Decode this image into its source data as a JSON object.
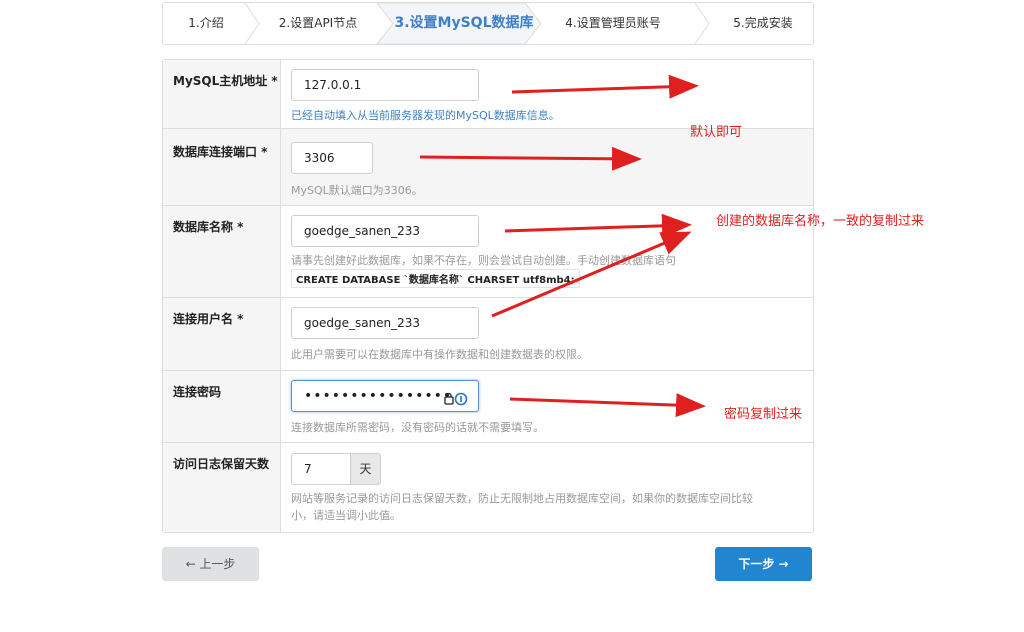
{
  "steps": [
    {
      "label": "1.介绍"
    },
    {
      "label": "2.设置API节点"
    },
    {
      "label": "3.设置MySQL数据库"
    },
    {
      "label": "4.设置管理员账号"
    },
    {
      "label": "5.完成安装"
    }
  ],
  "form": {
    "host": {
      "label": "MySQL主机地址 *",
      "value": "127.0.0.1",
      "hint": "已经自动填入从当前服务器发现的MySQL数据库信息。"
    },
    "port": {
      "label": "数据库连接端口 *",
      "value": "3306",
      "hint": "MySQL默认端口为3306。"
    },
    "dbname": {
      "label": "数据库名称 *",
      "value": "goedge_sanen_233",
      "hint": "请事先创建好此数据库，如果不存在，则会尝试自动创建。手动创建数据库语句",
      "code": "CREATE DATABASE `数据库名称` CHARSET utf8mb4;",
      "code_suffix": "。"
    },
    "user": {
      "label": "连接用户名 *",
      "value": "goedge_sanen_233",
      "hint": "此用户需要可以在数据库中有操作数据和创建数据表的权限。"
    },
    "password": {
      "label": "连接密码",
      "value": "••••••••••••••••",
      "hint": "连接数据库所需密码，没有密码的话就不需要填写。"
    },
    "log_days": {
      "label": "访问日志保留天数",
      "value": "7",
      "unit": "天",
      "hint_line1": "网站等服务记录的访问日志保留天数，防止无限制地占用数据库空间，如果你的数据库空间比较",
      "hint_line2": "小，请适当调小此值。"
    }
  },
  "buttons": {
    "prev": "← 上一步",
    "next": "下一步 →"
  },
  "annotations": {
    "default_ok": "默认即可",
    "db_name_note": "创建的数据库名称，一致的复制过来",
    "password_note": "密码复制过来"
  },
  "colors": {
    "accent": "#2185d0",
    "annotation": "#e01f1f",
    "hint_blue": "#3d81c4"
  }
}
